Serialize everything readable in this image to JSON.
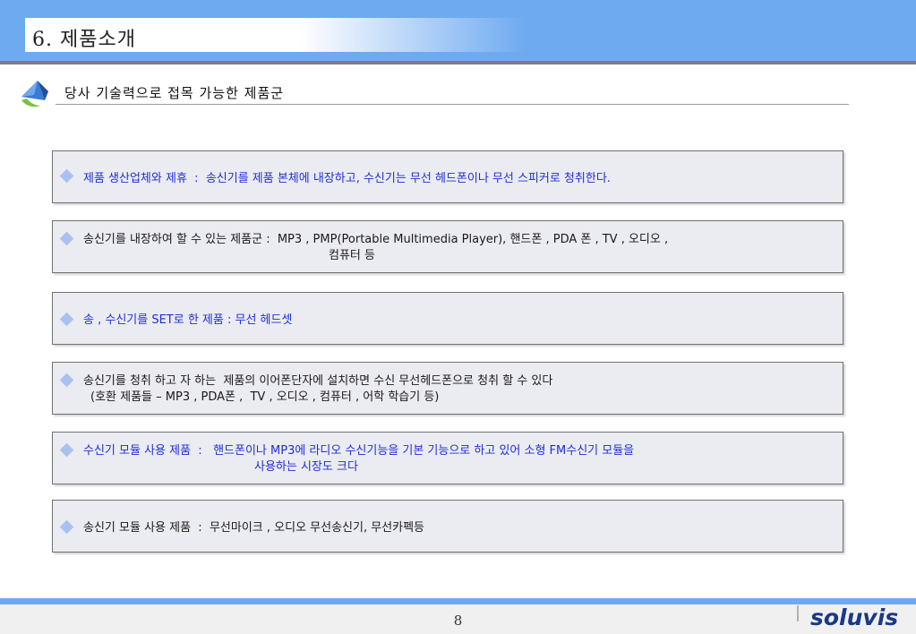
{
  "header": {
    "title": "6. 제품소개"
  },
  "section": {
    "title": "당사 기술력으로 접목 가능한 제품군"
  },
  "items": [
    {
      "line1": "제품 생산업체와 제휴  :  송신기를 제품 본체에 내장하고, 수신기는 무선 헤드폰이나 무선 스피커로 청취한다.",
      "line2": ""
    },
    {
      "line1": "송신기를 내장하여 할 수 있는 제품군 :  MP3 , PMP(Portable Multimedia Player), 핸드폰 , PDA 폰 , TV , 오디오 ,",
      "line2": "컴퓨터 등"
    },
    {
      "line1": "송 , 수신기를 SET로 한 제품 : 무선 헤드셋",
      "line2": ""
    },
    {
      "line1": "송신기를 청취 하고 자 하는  제품의 이어폰단자에 설치하면 수신 무선헤드폰으로 청취 할 수 있다",
      "line2": "(호환 제품들 – MP3 , PDA폰 ,  TV , 오디오 , 컴퓨터 , 어학 학습기 등)"
    },
    {
      "line1": "수신기 모듈 사용 제품  :   핸드폰이나 MP3에 라디오 수신기능을 기본 기능으로 하고 있어 소형 FM수신기 모듈을",
      "line2": "사용하는 시장도 크다"
    },
    {
      "line1": "송신기 모듈 사용 제품  :  무선마이크 , 오디오 무선송신기, 무선카펙등",
      "line2": ""
    }
  ],
  "footer": {
    "page_number": "8",
    "logo": "soluvis"
  },
  "colors": {
    "header_band": "#6eaaf0",
    "blue_text": "#1e2fd6",
    "box_bg": "#ebebf2",
    "logo": "#1a3a85"
  },
  "icons": {
    "section": "triangle-swoosh-icon",
    "bullet": "diamond-bullet-icon"
  }
}
